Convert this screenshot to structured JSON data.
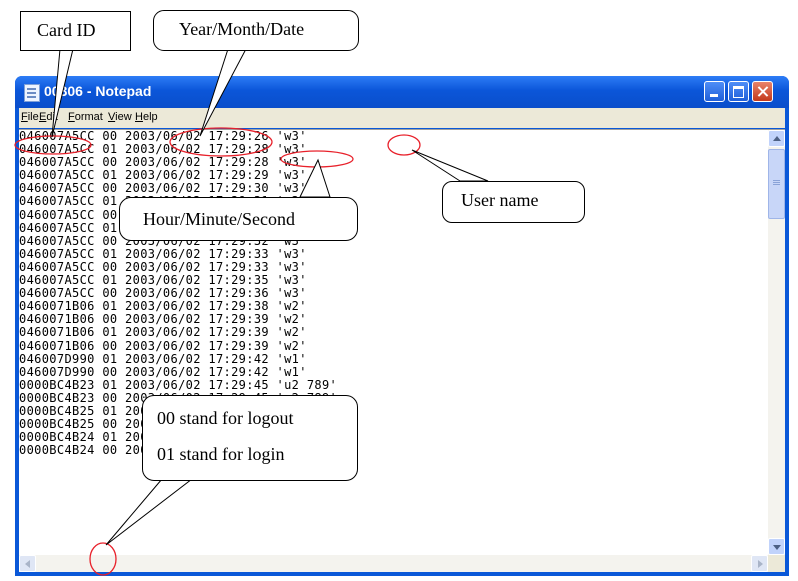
{
  "window": {
    "title": "00306 - Notepad",
    "menu": [
      "File",
      "Edit",
      "Format",
      "View",
      "Help"
    ]
  },
  "log_lines": [
    "046007A5CC 00 2003/06/02 17:29:26 'w3'",
    "046007A5CC 01 2003/06/02 17:29:28 'w3'",
    "046007A5CC 00 2003/06/02 17:29:28 'w3'",
    "046007A5CC 01 2003/06/02 17:29:29 'w3'",
    "046007A5CC 00 2003/06/02 17:29:30 'w3'",
    "046007A5CC 01 2003/06/02 17:29:31 'w3'",
    "046007A5CC 00 2003/06/02 17:29:31 'w3'",
    "046007A5CC 01 2003/06/02 17:29:32 'w3'",
    "046007A5CC 00 2003/06/02 17:29:32 'w3'",
    "046007A5CC 01 2003/06/02 17:29:33 'w3'",
    "046007A5CC 00 2003/06/02 17:29:33 'w3'",
    "046007A5CC 01 2003/06/02 17:29:35 'w3'",
    "046007A5CC 00 2003/06/02 17:29:36 'w3'",
    "0460071B06 01 2003/06/02 17:29:38 'w2'",
    "0460071B06 00 2003/06/02 17:29:39 'w2'",
    "0460071B06 01 2003/06/02 17:29:39 'w2'",
    "0460071B06 00 2003/06/02 17:29:39 'w2'",
    "046007D990 01 2003/06/02 17:29:42 'w1'",
    "046007D990 00 2003/06/02 17:29:42 'w1'",
    "0000BC4B23 01 2003/06/02 17:29:45 'u2 789'",
    "0000BC4B23 00 2003/06/02 17:29:45 'u2 789'",
    "0000BC4B25 01 2003/06/02 17:29:48 'u1 456'",
    "0000BC4B25 00 2003/06/02 17:29:48 'u1 456'",
    "0000BC4B24 01 2003/06/02 17:29:51 'adm 123'",
    "0000BC4B24 00 2003/06/02 17:30:02 'adm 123'"
  ],
  "callouts": {
    "card_id": "Card ID",
    "date": "Year/Month/Date",
    "time": "Hour/Minute/Second",
    "user": "User name",
    "status_logout": "00 stand for logout",
    "status_login": "01 stand for login"
  },
  "colors": {
    "highlight": "#e8202a",
    "titlebar": "#0b56d9"
  }
}
